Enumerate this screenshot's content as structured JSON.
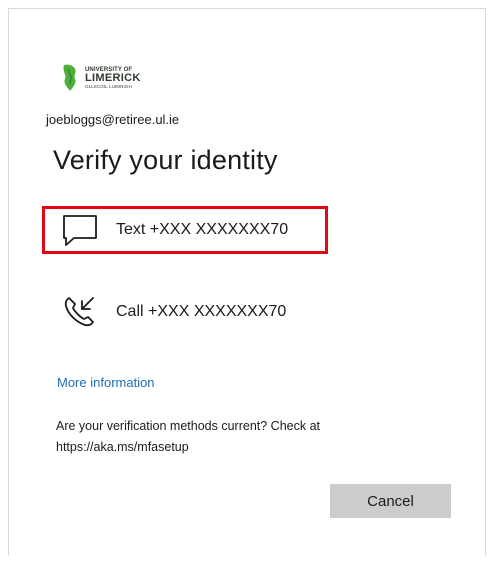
{
  "brand": {
    "line1": "UNIVERSITY OF",
    "line2": "LIMERICK",
    "line3": "OLLSCOIL LUIMNIGH",
    "color": "#4caf3a"
  },
  "account": {
    "email": "joebloggs@retiree.ul.ie"
  },
  "page": {
    "title": "Verify your identity"
  },
  "methods": [
    {
      "label": "Text +XXX XXXXXXX70",
      "icon": "chat-bubble-icon",
      "highlighted": true
    },
    {
      "label": "Call +XXX XXXXXXX70",
      "icon": "phone-incoming-icon",
      "highlighted": false
    }
  ],
  "links": {
    "more_info": "More information"
  },
  "notice": {
    "line1": "Are your verification methods current? Check at",
    "line2": "https://aka.ms/mfasetup"
  },
  "actions": {
    "cancel_label": "Cancel"
  },
  "colors": {
    "highlight": "#e30613",
    "link": "#1f6fb5",
    "button_bg": "#cccccc"
  }
}
